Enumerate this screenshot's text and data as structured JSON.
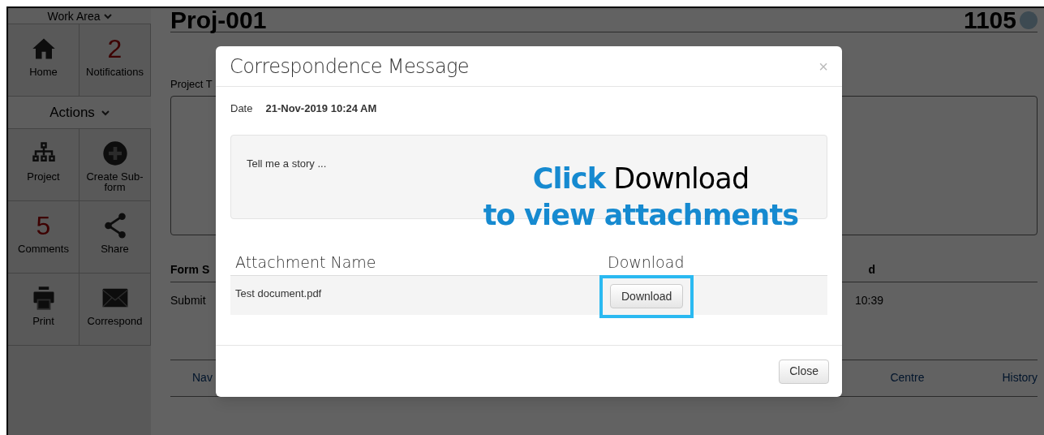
{
  "sidebar": {
    "work_area": "Work Area",
    "top_tiles": [
      {
        "kind": "home",
        "label": "Home"
      },
      {
        "kind": "count",
        "count": "2",
        "label": "Notifications"
      }
    ],
    "actions_header": "Actions",
    "action_tiles": [
      {
        "kind": "hierarchy",
        "label": "Project"
      },
      {
        "kind": "plus",
        "label": "Create Sub-form"
      },
      {
        "kind": "count",
        "count": "5",
        "label": "Comments"
      },
      {
        "kind": "share",
        "label": "Share"
      },
      {
        "kind": "print",
        "label": "Print"
      },
      {
        "kind": "mail",
        "label": "Correspond"
      }
    ]
  },
  "page": {
    "title": "Proj-001",
    "number": "1105",
    "project_label": "Project T",
    "table_header": "Form S",
    "table_header_end": "d",
    "table_cell": "Submit",
    "table_cell_end": "10:39",
    "nav_links": [
      "Nav",
      "Centre",
      "History"
    ]
  },
  "modal": {
    "title": "Correspondence Message",
    "close_glyph": "×",
    "date_label": "Date",
    "date_value": "21-Nov-2019 10:24 AM",
    "message": "Tell me a story ...",
    "columns": [
      "Attachment Name",
      "Download"
    ],
    "rows": [
      {
        "name": "Test document.pdf",
        "button": "Download",
        "highlighted": true
      }
    ],
    "footer_button": "Close"
  },
  "annotation": {
    "emphasis": "Click",
    "rest": "Download",
    "line2": "to view attachments"
  }
}
